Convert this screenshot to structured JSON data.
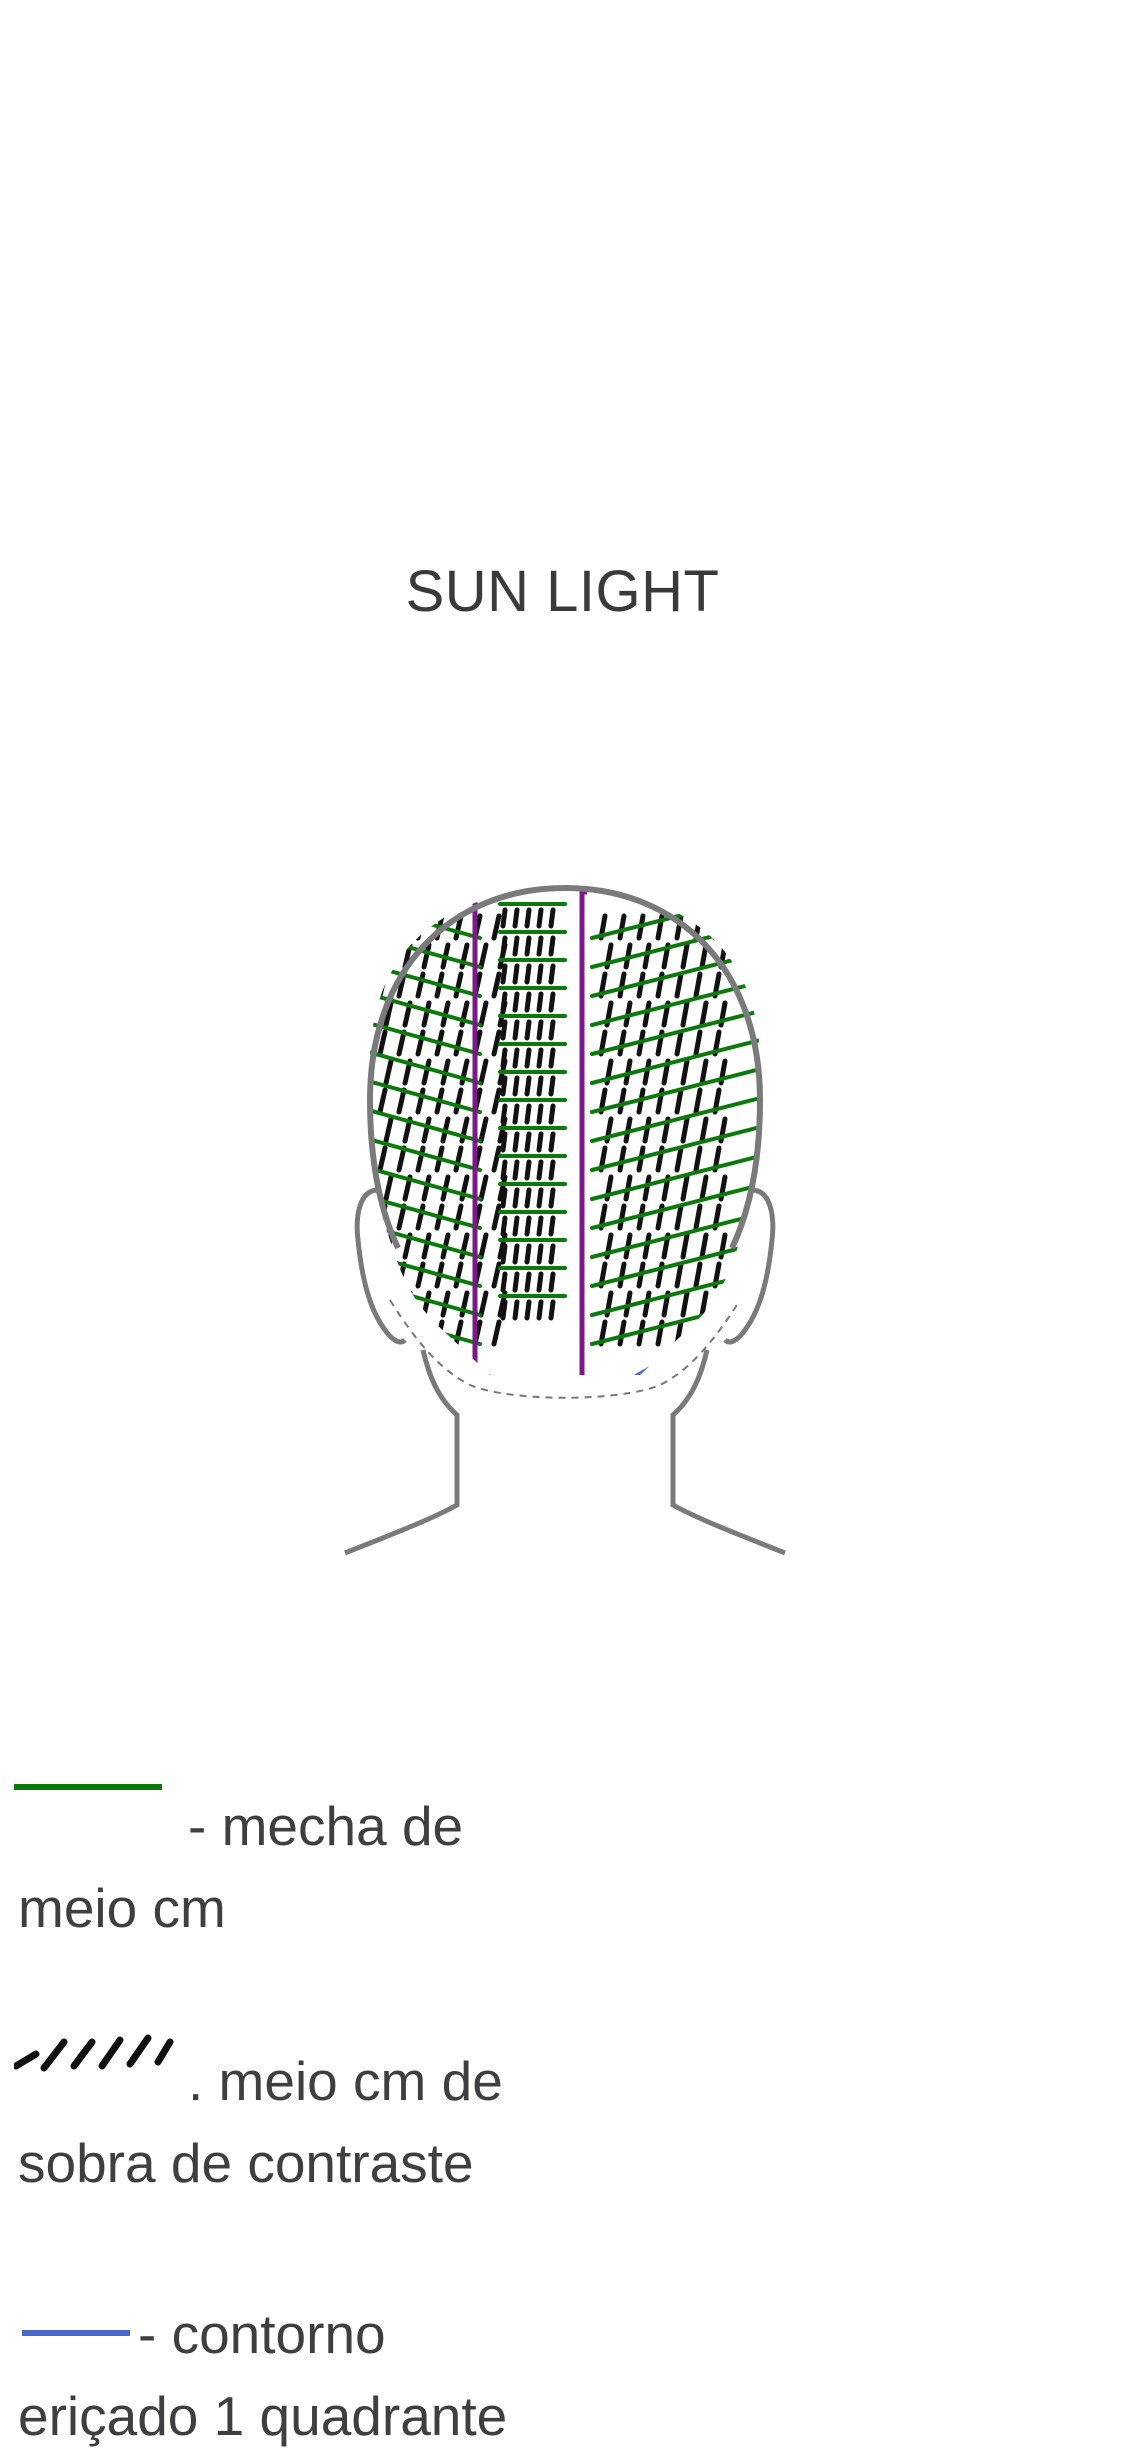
{
  "title": "SUN LIGHT",
  "legend": [
    {
      "swatch": "green-line",
      "color": "#0b7a0b",
      "line1": "- mecha de",
      "line2": "meio cm"
    },
    {
      "swatch": "black-dashes",
      "color": "#111111",
      "line1": ". meio cm de",
      "line2": "sobra de contraste"
    },
    {
      "swatch": "blue-line",
      "color": "#4a67c9",
      "line1": "- contorno",
      "line2": "eriçado 1 quadrante"
    }
  ],
  "colors": {
    "head_outline": "#7a7a7c",
    "green": "#0b7a0b",
    "purple": "#7a1a86",
    "blue": "#4a67c9",
    "black": "#111111"
  }
}
